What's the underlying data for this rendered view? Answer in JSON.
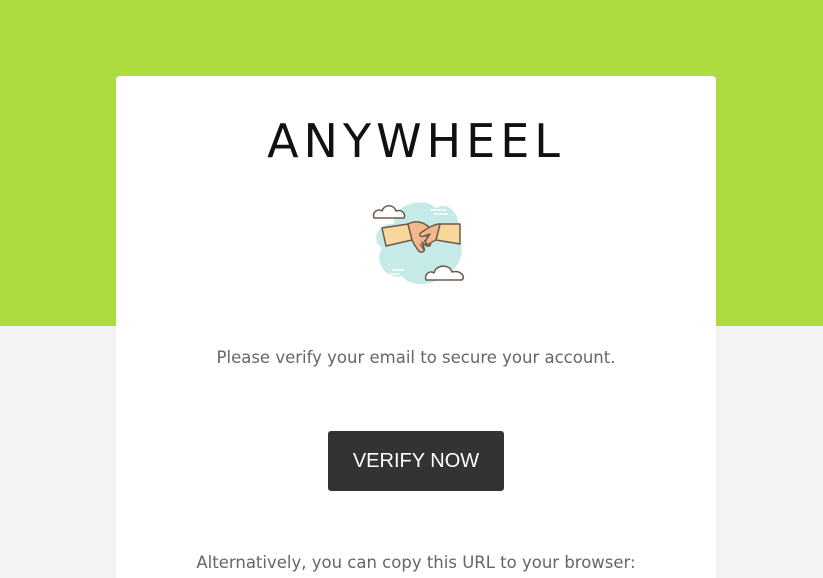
{
  "brand": {
    "name": "ANYWHEEL"
  },
  "illustration": {
    "icon": "handshake-icon"
  },
  "content": {
    "message": "Please verify your email to secure your account.",
    "verify_button_label": "VERIFY NOW",
    "alternative_text": "Alternatively, you can copy this URL to your browser:"
  },
  "colors": {
    "header_band": "#addc3f",
    "background": "#f3f3f3",
    "card": "#ffffff",
    "button": "#333333",
    "button_text": "#ffffff",
    "body_text": "#666666",
    "brand_text": "#111111"
  }
}
